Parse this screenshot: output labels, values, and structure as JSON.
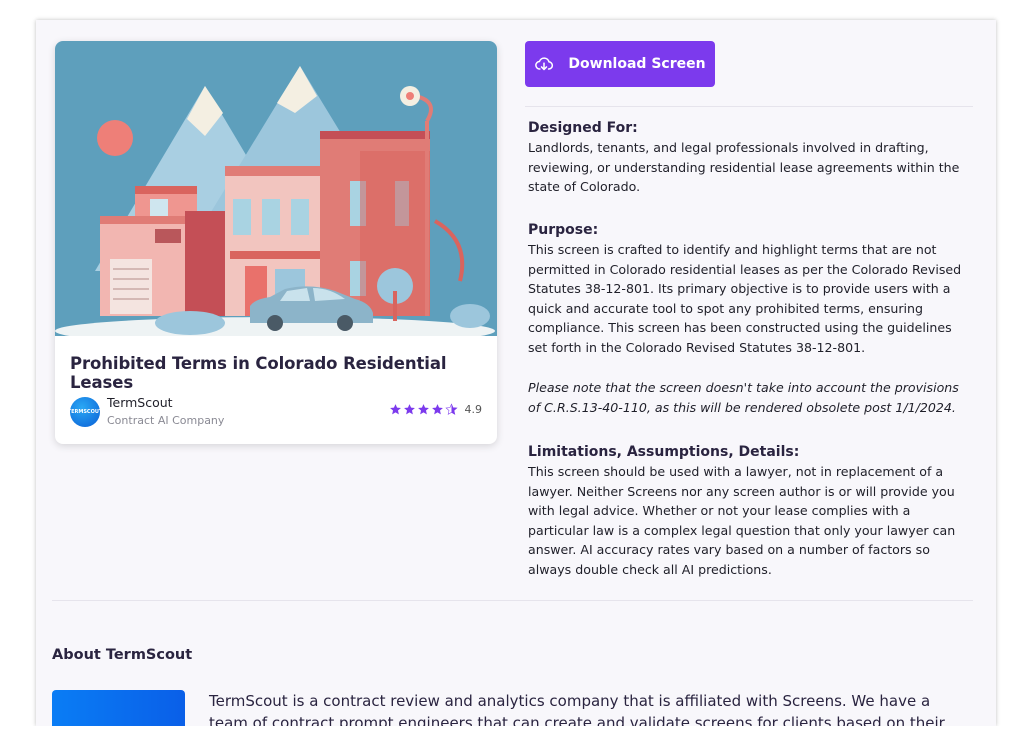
{
  "card": {
    "title": "Prohibited Terms in Colorado Residential Leases",
    "company_name": "TermScout",
    "company_sub": "Contract AI Company",
    "logo_text": "TERMSCOUT",
    "rating": "4.9",
    "stars": 4.5
  },
  "download_button": {
    "label": "Download Screen",
    "icon": "cloud-download-icon"
  },
  "sections": {
    "designed_for": {
      "heading": "Designed For:",
      "body": "Landlords, tenants, and legal professionals involved in drafting, reviewing, or understanding residential lease agreements within the state of Colorado."
    },
    "purpose": {
      "heading": "Purpose:",
      "body": "This screen is crafted to identify and highlight terms that are not permitted in Colorado residential leases as per the Colorado Revised Statutes 38-12-801. Its primary objective is to provide users with a quick and accurate tool to spot any prohibited terms, ensuring compliance. This screen has been constructed using the guidelines set forth in the Colorado Revised Statutes 38-12-801.",
      "note": "Please note that the screen doesn't take into account the provisions of C.R.S.13-40-110, as this will be rendered obsolete post 1/1/2024."
    },
    "limitations": {
      "heading": "Limitations, Assumptions, Details:",
      "body": "This screen should be used with a lawyer, not in replacement of a lawyer. Neither Screens nor any screen author is or will provide you with legal advice. Whether or not your lease complies with a particular law is a complex legal question that only your lawyer can answer. AI accuracy rates vary based on a number of factors so always double check all AI predictions."
    }
  },
  "about": {
    "title": "About TermScout",
    "text": "TermScout is a contract review and analytics company that is affiliated with Screens. We have a team of contract prompt engineers that can create and validate screens for clients based on their existing playbooks or"
  },
  "colors": {
    "accent": "#7c3aed",
    "star": "#7c3aed"
  }
}
